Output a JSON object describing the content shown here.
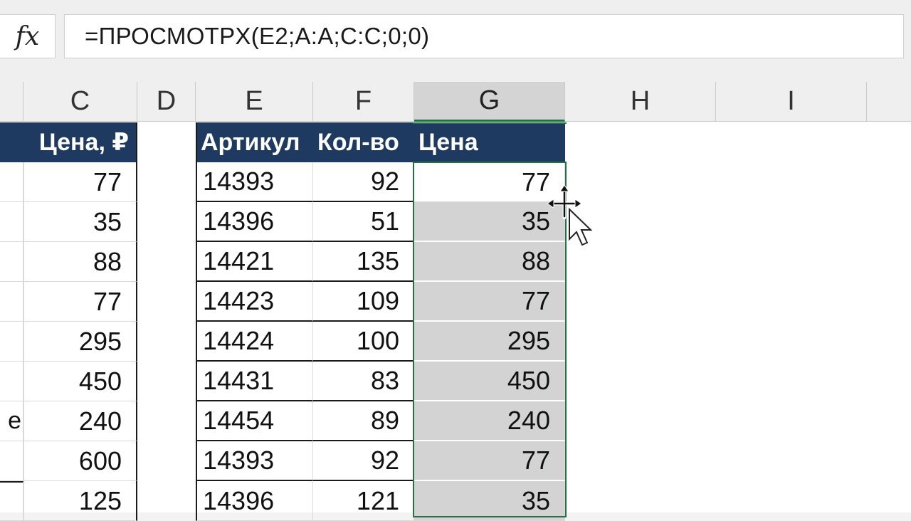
{
  "formula_bar": {
    "fx_label": "fx",
    "formula": "=ПРОСМОТРX(E2;A:A;C:C;0;0)"
  },
  "columns": [
    "C",
    "D",
    "E",
    "F",
    "G",
    "H",
    "I"
  ],
  "left_table": {
    "header_c": "Цена, ₽",
    "partial_text_row7": "e",
    "prices": [
      "77",
      "35",
      "88",
      "77",
      "295",
      "450",
      "240",
      "600",
      "125"
    ]
  },
  "right_table": {
    "headers": {
      "article": "Артикул",
      "qty": "Кол-во",
      "price": "Цена"
    },
    "rows": [
      {
        "article": "14393",
        "qty": "92",
        "price": "77"
      },
      {
        "article": "14396",
        "qty": "51",
        "price": "35"
      },
      {
        "article": "14421",
        "qty": "135",
        "price": "88"
      },
      {
        "article": "14423",
        "qty": "109",
        "price": "77"
      },
      {
        "article": "14424",
        "qty": "100",
        "price": "295"
      },
      {
        "article": "14431",
        "qty": "83",
        "price": "450"
      },
      {
        "article": "14454",
        "qty": "89",
        "price": "240"
      },
      {
        "article": "14393",
        "qty": "92",
        "price": "77"
      },
      {
        "article": "14396",
        "qty": "121",
        "price": "35"
      }
    ]
  },
  "colors": {
    "header_fill": "#1f3a60",
    "selection_border": "#217346",
    "selection_fill": "#d3d3d3"
  },
  "icons": {
    "cursor": "move-cursor-icon",
    "pointer": "arrow-pointer-icon"
  }
}
